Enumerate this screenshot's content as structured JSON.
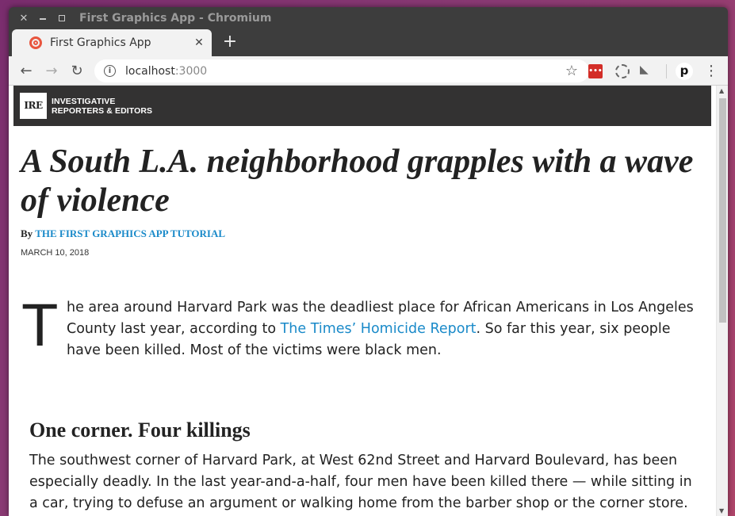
{
  "window": {
    "title": "First Graphics App - Chromium",
    "close_glyph": "✕",
    "newtab_glyph": "+"
  },
  "tab": {
    "title": "First Graphics App",
    "close_glyph": "✕"
  },
  "toolbar": {
    "back_glyph": "←",
    "forward_glyph": "→",
    "reload_glyph": "↻",
    "url_host": "localhost",
    "url_port": ":3000",
    "star_glyph": "☆",
    "ext_p_label": "p",
    "menu_glyph": "⋮"
  },
  "site": {
    "logo_text": "IRE",
    "org_line1": "INVESTIGATIVE",
    "org_line2": "REPORTERS & EDITORS"
  },
  "article": {
    "headline": "A South L.A. neighborhood grapples with a wave of violence",
    "byline_prefix": "By ",
    "byline_author": "The First Graphics App Tutorial",
    "date": "March 10, 2018",
    "dropcap": "T",
    "lede_part1": "he area around Harvard Park was the deadliest place for African Americans in Los Angeles County last year, according to ",
    "lede_link": "The Times’ Homicide Report",
    "lede_part2": ". So far this year, six people have been killed. Most of the victims were black men.",
    "subhead": "One corner. Four killings",
    "body": "The southwest corner of Harvard Park, at West 62nd Street and Harvard Boulevard, has been especially deadly. In the last year-and-a-half, four men have been killed there — while sitting in a car, trying to defuse an argument or walking home from the barber shop or the corner store."
  },
  "colors": {
    "link": "#1a8ac9",
    "header_bg": "#333232",
    "lastpass_red": "#d32d27"
  }
}
